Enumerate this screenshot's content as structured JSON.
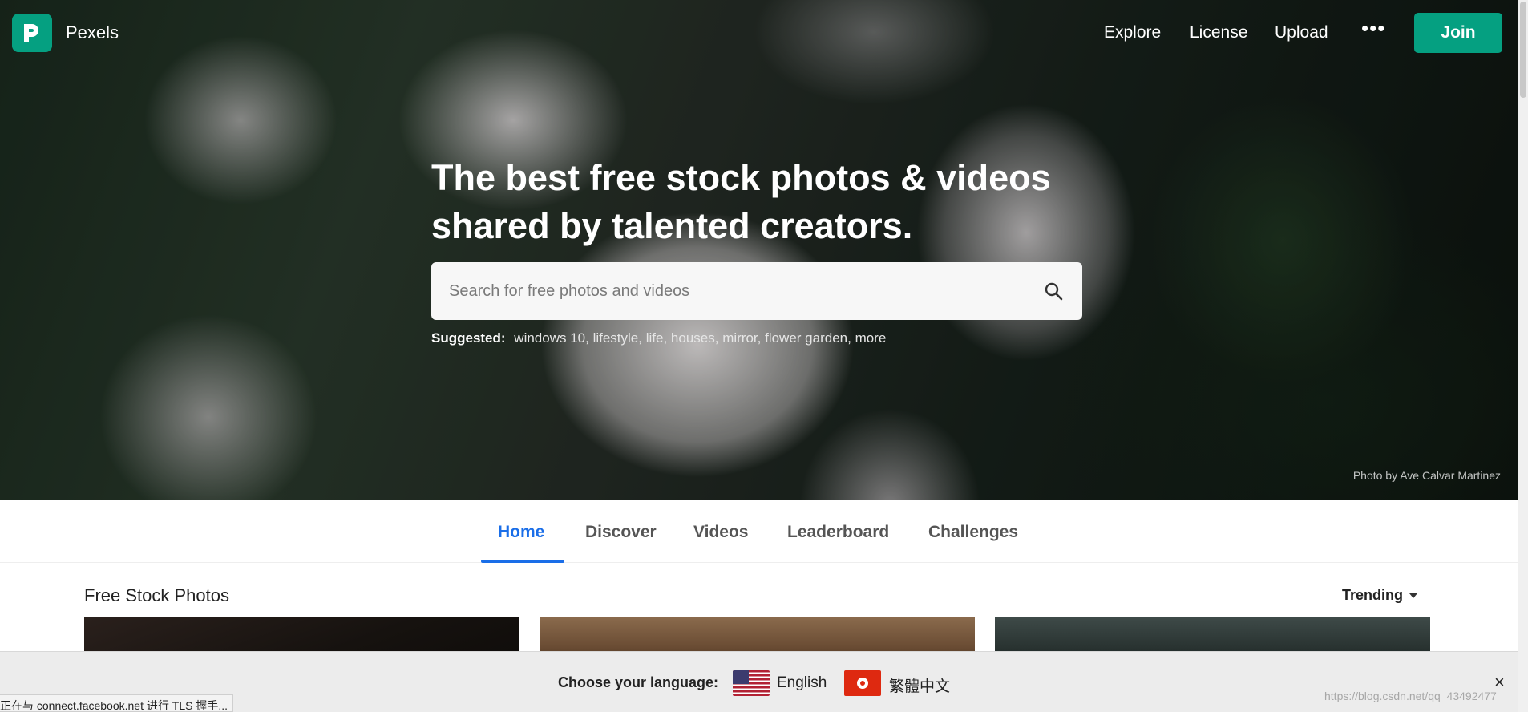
{
  "brand": {
    "name": "Pexels",
    "logo_icon": "pexels-logo-icon",
    "accent": "#05a081"
  },
  "nav": {
    "links": [
      "Explore",
      "License",
      "Upload"
    ],
    "more": "•••",
    "join": "Join"
  },
  "hero": {
    "headline_line1": "The best free stock photos & videos",
    "headline_line2": "shared by talented creators.",
    "search_placeholder": "Search for free photos and videos",
    "suggested_label": "Suggested:",
    "suggested_items": [
      "windows 10",
      "lifestyle",
      "life",
      "houses",
      "mirror",
      "flower garden",
      "more"
    ],
    "credit": "Photo by Ave Calvar Martinez"
  },
  "tabs": {
    "items": [
      "Home",
      "Discover",
      "Videos",
      "Leaderboard",
      "Challenges"
    ],
    "active": "Home",
    "active_color": "#1a6ee8"
  },
  "content": {
    "section_title": "Free Stock Photos",
    "sort_label": "Trending"
  },
  "language_bar": {
    "prompt": "Choose your language:",
    "options": [
      {
        "label": "English",
        "flag": "us-flag-icon"
      },
      {
        "label": "繁體中文",
        "flag": "hk-flag-icon"
      }
    ],
    "close": "×"
  },
  "browser": {
    "status_text": "正在与 connect.facebook.net 进行 TLS 握手...",
    "watermark": "https://blog.csdn.net/qq_43492477"
  }
}
